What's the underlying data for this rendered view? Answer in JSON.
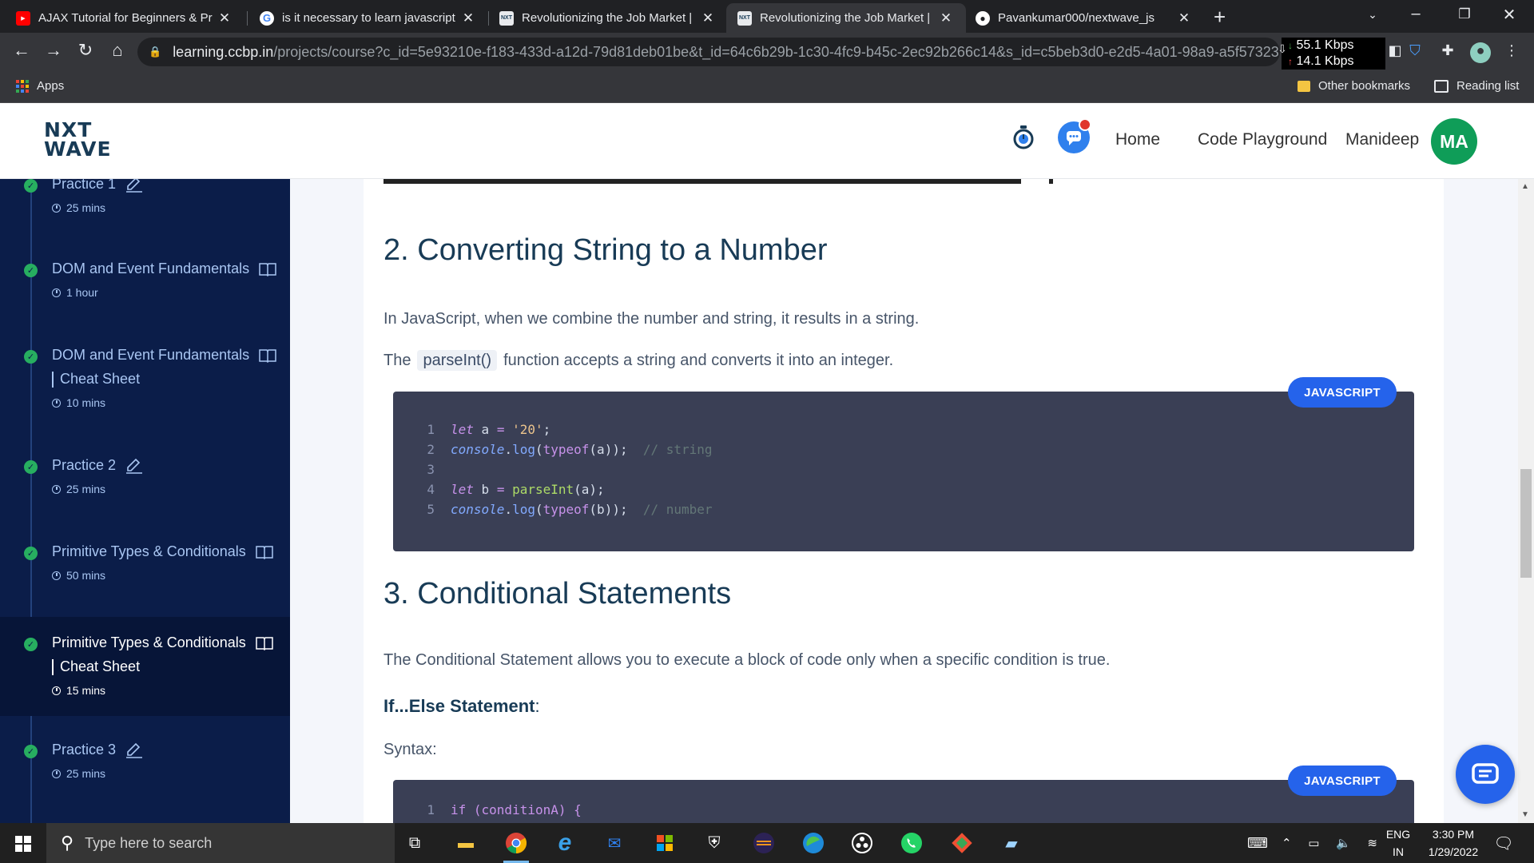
{
  "browser": {
    "tabs": [
      {
        "title": "AJAX Tutorial for Beginners & Pr",
        "favicon": "youtube-icon",
        "active": false
      },
      {
        "title": "is it necessary to learn javascript",
        "favicon": "google-icon",
        "active": false
      },
      {
        "title": "Revolutionizing the Job Market |",
        "favicon": "nxtwave-icon",
        "active": false
      },
      {
        "title": "Revolutionizing the Job Market |",
        "favicon": "nxtwave-icon",
        "active": true
      },
      {
        "title": "Pavankumar000/nextwave_js",
        "favicon": "github-icon",
        "active": false
      }
    ],
    "url_host": "learning.ccbp.in",
    "url_path": "/projects/course?c_id=5e93210e-f183-433d-a12d-79d81deb01be&t_id=64c6b29b-1c30-4fc9-b45c-2ec92b266c14&s_id=c5beb3d0-e2d5-4a01-98a9-a5f57323...",
    "net_down": "55.1 Kbps",
    "net_up": "14.1 Kbps",
    "bookmarks": {
      "apps": "Apps",
      "other": "Other bookmarks",
      "reading": "Reading list"
    }
  },
  "site": {
    "logo_line1": "NXT",
    "logo_line2": "WAVE",
    "nav": {
      "home": "Home",
      "playground": "Code Playground",
      "user": "Manideep",
      "avatar": "MA"
    }
  },
  "sidebar": {
    "items": [
      {
        "title": "Practice 1",
        "sub": "",
        "duration": "25 mins",
        "kind": "practice-icon",
        "active": false
      },
      {
        "title": "DOM and Event Fundamentals",
        "sub": "",
        "duration": "1 hour",
        "kind": "book-icon",
        "active": false
      },
      {
        "title": "DOM and Event Fundamentals",
        "sub": "Cheat Sheet",
        "duration": "10 mins",
        "kind": "book-icon",
        "active": false
      },
      {
        "title": "Practice 2",
        "sub": "",
        "duration": "25 mins",
        "kind": "practice-icon",
        "active": false
      },
      {
        "title": "Primitive Types & Conditionals",
        "sub": "",
        "duration": "50 mins",
        "kind": "book-icon",
        "active": false
      },
      {
        "title": "Primitive Types & Conditionals",
        "sub": "Cheat Sheet",
        "duration": "15 mins",
        "kind": "book-icon",
        "active": true
      },
      {
        "title": "Practice 3",
        "sub": "",
        "duration": "25 mins",
        "kind": "practice-icon",
        "active": false
      }
    ]
  },
  "content": {
    "section2_title": "2. Converting String to a Number",
    "section2_para1": "In JavaScript, when we combine the number and string, it results in a string.",
    "section2_para2_pre": "The",
    "section2_para2_code": "parseInt()",
    "section2_para2_post": "function accepts a string and converts it into an integer.",
    "code1_lang": "JAVASCRIPT",
    "code1_lines": [
      {
        "n": "1",
        "text": "let a = '20';"
      },
      {
        "n": "2",
        "text": "console.log(typeof(a));  // string"
      },
      {
        "n": "3",
        "text": ""
      },
      {
        "n": "4",
        "text": "let b = parseInt(a);"
      },
      {
        "n": "5",
        "text": "console.log(typeof(b));  // number"
      }
    ],
    "section3_title": "3. Conditional Statements",
    "section3_para": "The Conditional Statement allows you to execute a block of code only when a specific condition is true.",
    "ifelse_heading": "If...Else Statement",
    "ifelse_colon": ":",
    "syntax_label": "Syntax:",
    "code2_lang": "JAVASCRIPT",
    "code2_line1_n": "1",
    "code2_line1_text": "if (conditionA) {"
  },
  "taskbar": {
    "search_placeholder": "Type here to search",
    "lang": "ENG",
    "region": "IN",
    "time": "3:30 PM",
    "date": "1/29/2022"
  },
  "colors": {
    "sidebar_bg": "#0b1d49",
    "accent_blue": "#2563eb",
    "check_green": "#27ae60",
    "avatar_green": "#0f9d58",
    "heading": "#183b56"
  }
}
